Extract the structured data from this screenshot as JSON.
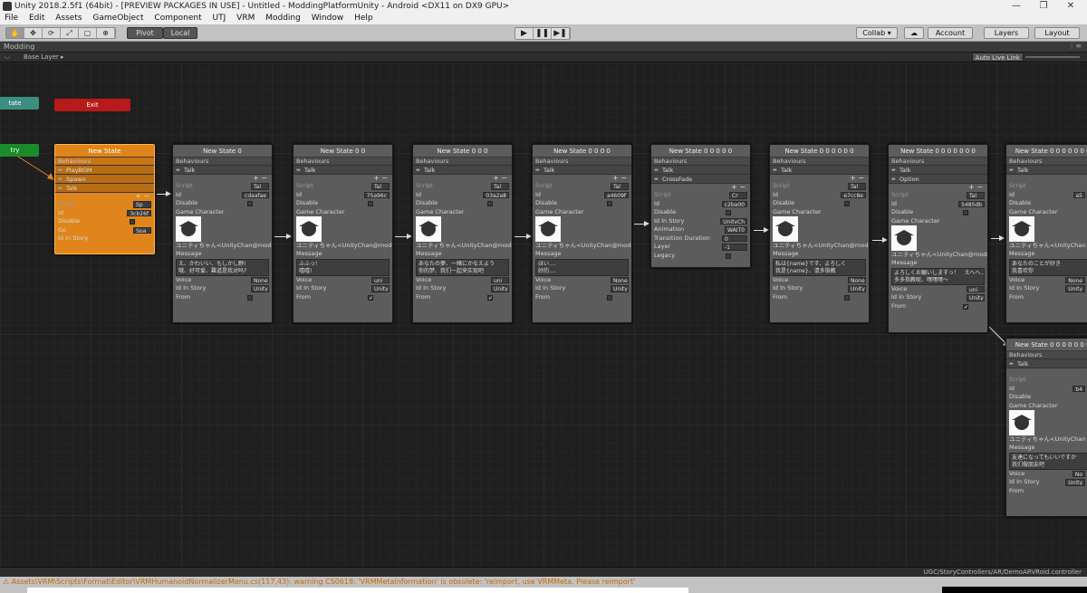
{
  "window": {
    "title": "Unity 2018.2.5f1 (64bit) - [PREVIEW PACKAGES IN USE] - Untitled - ModdingPlatformUnity - Android <DX11 on DX9 GPU>",
    "controls": [
      "—",
      "❐",
      "✕"
    ]
  },
  "menu": [
    "File",
    "Edit",
    "Assets",
    "GameObject",
    "Component",
    "UTJ",
    "VRM",
    "Modding",
    "Window",
    "Help"
  ],
  "toolbar": {
    "tools": [
      "✋",
      "✥",
      "⟳",
      "⤢",
      "▢",
      "⊕"
    ],
    "pivot": "Pivot",
    "local": "Local",
    "play": [
      "▶",
      "❚❚",
      "▶❚"
    ],
    "collab": "Collab ▾",
    "account": "Account",
    "layers": "Layers",
    "layout": "Layout"
  },
  "tab": {
    "label": "Modding"
  },
  "layer": {
    "base": "Base Layer ▸",
    "auto_live_link": "Auto Live Link"
  },
  "graph_pills": {
    "state_partial": "tate",
    "exit": "Exit",
    "entry_partial": "try"
  },
  "labels": {
    "behaviours": "Behaviours",
    "script": "Script",
    "id": "Id",
    "disable": "Disable",
    "game_character": "Game Character",
    "message": "Message",
    "voice": "Voice",
    "id_in_story": "Id In Story",
    "from": "From",
    "go": "Go",
    "animation": "Animation",
    "transition_duration": "Transition Duration",
    "layer": "Layer",
    "legacy": "Legacy",
    "plus_minus": "+ −"
  },
  "nodes": [
    {
      "title": "New State",
      "behaviours": [
        "PlayBGM",
        "Spawn",
        "Talk"
      ],
      "script": "Sp",
      "id": "3cb26f",
      "go": "Spa"
    },
    {
      "title": "New State 0",
      "behaviours": [
        "Talk"
      ],
      "script": "Tal",
      "id": "cdaafae",
      "character": "ユニティちゃん<UnityChan@moddir",
      "message": "え、かわいい、もしかし野!\n哦、好可爱、難道是我对吗?",
      "voice": "None",
      "id_in_story": "UnityC",
      "from_checked": false
    },
    {
      "title": "New State 0 0",
      "behaviours": [
        "Talk"
      ],
      "script": "Tal",
      "id": "75a96c",
      "character": "ユニティちゃん<UnityChan@moddir",
      "message": "ふふっ!\n嘻嘻!",
      "voice": "uni",
      "id_in_story": "UnityC",
      "from_checked": true
    },
    {
      "title": "New State 0 0 0",
      "behaviours": [
        "Talk"
      ],
      "script": "Tal",
      "id": "03a2a8",
      "character": "ユニティちゃん<UnityChan@moddin",
      "message": "あなたの夢、一緒にかなえよう\n你的梦、我们一起来实现吧",
      "voice": "uni",
      "id_in_story": "UnityCh",
      "from_checked": true
    },
    {
      "title": "New State 0 0 0 0",
      "behaviours": [
        "Talk"
      ],
      "script": "Tal",
      "id": "a4609f",
      "character": "ユニティちゃん<UnityChan@moddin",
      "message": "ほい....\n好的....",
      "voice": "None",
      "id_in_story": "UnityCh",
      "from_checked": false
    },
    {
      "title": "New State 0 0 0 0 0",
      "behaviours": [
        "Talk",
        "CrossFade"
      ],
      "script": "Cr",
      "id": "c2ba00",
      "id_in_story": "UnityCh",
      "animation": "WAIT0",
      "transition_duration": "0",
      "layer": "-1"
    },
    {
      "title": "New State 0 0 0 0 0 0",
      "behaviours": [
        "Talk"
      ],
      "script": "Tal",
      "id": "e7cc8e",
      "character": "ユニティちゃん<UnityChan@moddin",
      "message": "私は{name}です、よろしく\n我是{name}、请多指教",
      "voice": "None",
      "id_in_story": "UnityCh",
      "from_checked": false
    },
    {
      "title": "New State 0 0 0 0 0 0 0",
      "behaviours": [
        "Talk",
        "Option"
      ],
      "script": "Tal",
      "id": "5485db",
      "character": "ユニティちゃん<UnityChan@moddin",
      "message": "よろしくお願いしますっ！　えへへ...\n多多指教呢、嘿嘿嘿～",
      "voice": "uni",
      "id_in_story": "UnityCh",
      "from_checked": true
    },
    {
      "title": "New State 0 0 0 0 0 0 0 0",
      "behaviours": [
        "Talk"
      ],
      "script": "Tal",
      "id": "a5",
      "character": "ユニティちゃん<UnityChan",
      "message": "あなたのことが好き\n我喜欢你",
      "voice": "None",
      "id_in_story": "Unity",
      "from_checked": false
    },
    {
      "title": "New State 0 0 0 0 0 0 0 0",
      "behaviours": [
        "Talk"
      ],
      "script": "Tal",
      "id": "b4",
      "character": "ユニティちゃん<UnityChan",
      "message": "友達になってもいいですか\n我们做朋友吧",
      "voice": "No",
      "id_in_story": "Unity",
      "from_checked": false
    }
  ],
  "status": {
    "path": "UGC/StoryControllers/AR/DemoARVRoid.controller",
    "console": "⚠ Assets\\VRM\\Scripts\\Format\\Editor\\VRMHumanoidNormalizerMenu.cs(117,43): warning CS0618: 'VRMMetaInformation' is obsolete: 'reimport, use VRMMeta. Please reimport'"
  }
}
